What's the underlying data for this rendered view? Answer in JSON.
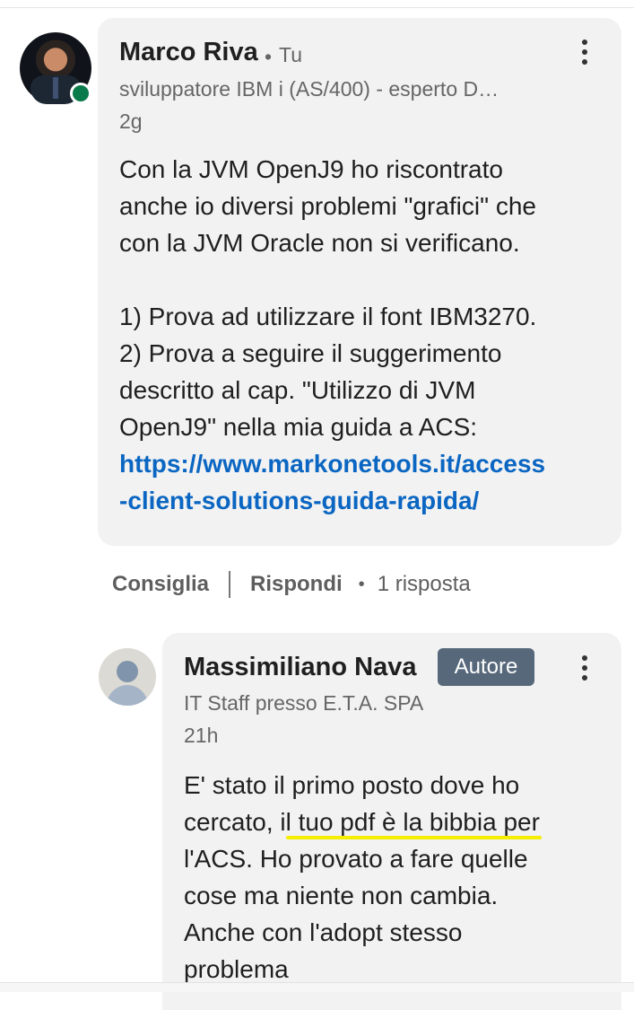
{
  "comment": {
    "author": "Marco Riva",
    "degree_sep": "•",
    "degree": "Tu",
    "headline": "sviluppatore IBM i (AS/400) - esperto D…",
    "time": "2g",
    "body_lines": [
      "Con la JVM OpenJ9 ho riscontrato",
      "anche io diversi problemi \"grafici\" che",
      "con la JVM Oracle non si verificano.",
      "",
      "1) Prova ad utilizzare il font IBM3270.",
      "2) Prova a seguire il suggerimento",
      "descritto al cap. \"Utilizzo di JVM",
      "OpenJ9\" nella mia guida a ACS:"
    ],
    "link_lines": [
      "https://www.markonetools.it/access",
      "-client-solutions-guida-rapida/"
    ]
  },
  "actions": {
    "like": "Consiglia",
    "reply": "Rispondi",
    "bullet": "•",
    "replies": "1 risposta"
  },
  "reply": {
    "author": "Massimiliano Nava",
    "badge": "Autore",
    "headline": "IT Staff presso E.T.A. SPA",
    "time": "21h",
    "body_lines": [
      "E' stato il primo posto dove ho",
      "cercato, il tuo pdf è la bibbia per",
      "l'ACS. Ho provato a fare quelle",
      "cose ma niente non cambia.",
      "Anche con l'adopt stesso",
      "problema"
    ]
  },
  "colors": {
    "link": "#0a66c2",
    "online": "#0b7a4b",
    "badge": "#56687a",
    "highlight": "#f5ee00"
  },
  "icons": [
    "more-vertical-icon",
    "online-status-icon",
    "avatar-placeholder-icon"
  ]
}
